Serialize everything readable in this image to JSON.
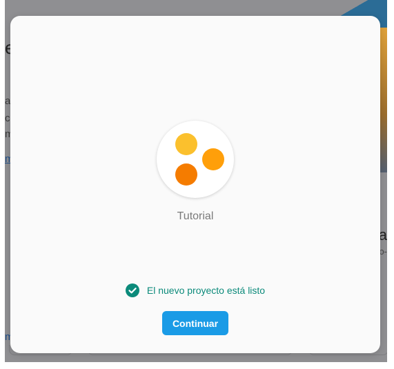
{
  "background": {
    "fragments": {
      "heading_e": "e",
      "line_a": "a",
      "line_co": "co",
      "line_m": "m",
      "link_m": "m",
      "bottom_link_m": "m",
      "right_ca": "ca",
      "right_small": "o-"
    }
  },
  "modal": {
    "project": {
      "logo_icon": "three-dots-project-logo",
      "name": "Tutorial"
    },
    "status": {
      "icon": "check-circle-icon",
      "text": "El nuevo proyecto está listo"
    },
    "continue_label": "Continuar"
  },
  "colors": {
    "accent": "#1a9be6",
    "success": "#0b8a7a",
    "dot_yellow": "#fbc02d",
    "dot_amber": "#ff9f0a",
    "dot_orange": "#f57c00"
  }
}
